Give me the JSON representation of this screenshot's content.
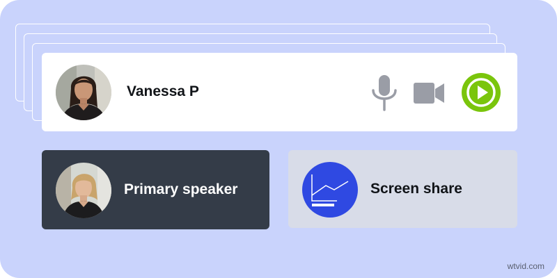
{
  "participant": {
    "name": "Vanessa P",
    "avatar_icon": "woman-portrait"
  },
  "controls": {
    "mic_icon": "microphone-icon",
    "camera_icon": "video-camera-icon",
    "play_icon": "play-icon"
  },
  "tiles": {
    "primary_speaker_label": "Primary speaker",
    "screen_share_label": "Screen share"
  },
  "watermark": "wtvid.com",
  "colors": {
    "background": "#c9d3fc",
    "card": "#ffffff",
    "speaker_card": "#343c48",
    "share_card": "#d8dce8",
    "play_green": "#7ac50c",
    "share_blue": "#2f49e2",
    "icon_gray": "#9a9da6"
  }
}
